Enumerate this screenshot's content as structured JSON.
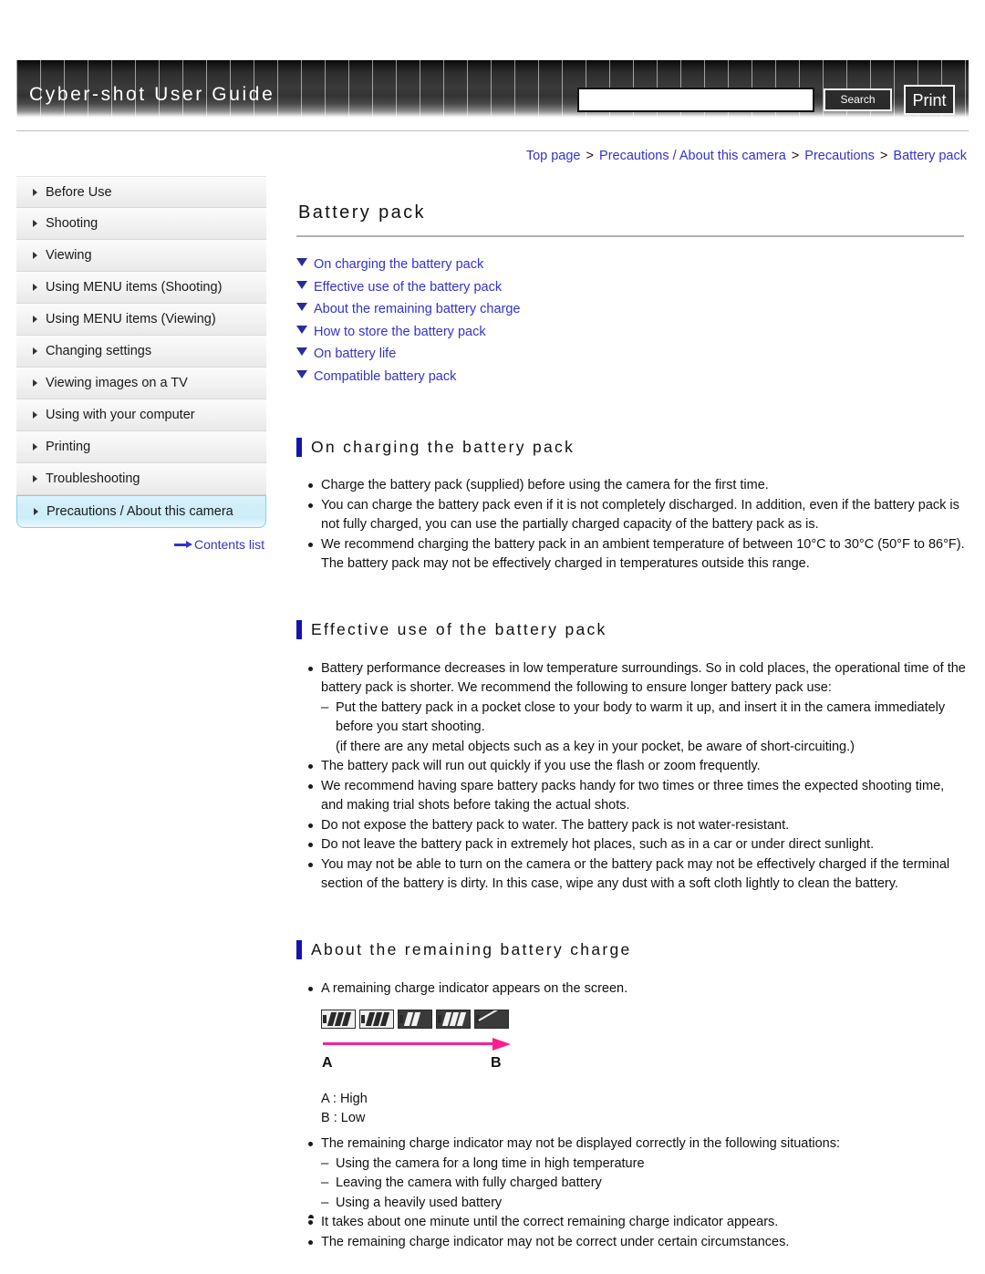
{
  "header": {
    "title": "Cyber-shot User Guide",
    "search_value": "",
    "search_placeholder": "",
    "search_button": "Search",
    "print_button": "Print"
  },
  "breadcrumb": {
    "items": [
      "Top page",
      "Precautions / About this camera",
      "Precautions",
      "Battery pack"
    ],
    "separator": ">"
  },
  "sidebar": {
    "items": [
      {
        "label": "Before Use",
        "active": false
      },
      {
        "label": "Shooting",
        "active": false
      },
      {
        "label": "Viewing",
        "active": false
      },
      {
        "label": "Using MENU items (Shooting)",
        "active": false
      },
      {
        "label": "Using MENU items (Viewing)",
        "active": false
      },
      {
        "label": "Changing settings",
        "active": false
      },
      {
        "label": "Viewing images on a TV",
        "active": false
      },
      {
        "label": "Using with your computer",
        "active": false
      },
      {
        "label": "Printing",
        "active": false
      },
      {
        "label": "Troubleshooting",
        "active": false
      },
      {
        "label": "Precautions / About this camera",
        "active": true
      }
    ],
    "contents_link": "Contents list"
  },
  "main": {
    "page_title": "Battery pack",
    "jump_links": [
      "On charging the battery pack",
      "Effective use of the battery pack",
      "About the remaining battery charge",
      "How to store the battery pack",
      "On battery life",
      "Compatible battery pack"
    ],
    "sections": [
      {
        "heading": "On charging the battery pack",
        "items": [
          {
            "type": "bullet",
            "text": "Charge the battery pack (supplied) before using the camera for the first time."
          },
          {
            "type": "bullet",
            "text": "You can charge the battery pack even if it is not completely discharged. In addition, even if the battery pack is not fully charged, you can use the partially charged capacity of the battery pack as is."
          },
          {
            "type": "bullet",
            "text": "We recommend charging the battery pack in an ambient temperature of between 10°C to 30°C (50°F to 86°F). The battery pack may not be effectively charged in temperatures outside this range."
          }
        ]
      },
      {
        "heading": "Effective use of the battery pack",
        "items": [
          {
            "type": "bullet",
            "text": "Battery performance decreases in low temperature surroundings. So in cold places, the operational time of the battery pack is shorter. We recommend the following to ensure longer battery pack use:"
          },
          {
            "type": "dash",
            "text": "Put the battery pack in a pocket close to your body to warm it up, and insert it in the camera immediately before you start shooting."
          },
          {
            "type": "plain",
            "text": "(if there are any metal objects such as a key in your pocket, be aware of short-circuiting.)"
          },
          {
            "type": "bullet",
            "text": "The battery pack will run out quickly if you use the flash or zoom frequently."
          },
          {
            "type": "bullet",
            "text": "We recommend having spare battery packs handy for two times or three times the expected shooting time, and making trial shots before taking the actual shots."
          },
          {
            "type": "bullet",
            "text": "Do not expose the battery pack to water. The battery pack is not water-resistant."
          },
          {
            "type": "bullet",
            "text": "Do not leave the battery pack in extremely hot places, such as in a car or under direct sunlight."
          },
          {
            "type": "bullet",
            "text": "You may not be able to turn on the camera or the battery pack may not be effectively charged if the terminal section of the battery is dirty. In this case, wipe any dust with a soft cloth lightly to clean the battery."
          }
        ]
      },
      {
        "heading": "About the remaining battery charge",
        "items": [
          {
            "type": "bullet",
            "text": "A remaining charge indicator appears on the screen."
          }
        ]
      }
    ],
    "battery_figure": {
      "label_a": "A",
      "label_b": "B",
      "legend_a": "A : High",
      "legend_b": "B : Low",
      "arrow_color": "#ff1e8e",
      "indicators": [
        {
          "bars": 3,
          "style": "light",
          "empty": false
        },
        {
          "bars": 3,
          "style": "light",
          "empty": false
        },
        {
          "bars": 2,
          "style": "dark",
          "empty": false
        },
        {
          "bars": 3,
          "style": "dark",
          "empty": false
        },
        {
          "bars": 0,
          "style": "dark",
          "empty": true
        }
      ]
    },
    "post_figure_items": [
      {
        "type": "bullet",
        "text": "The remaining charge indicator may not be displayed correctly in the following situations:"
      },
      {
        "type": "dash",
        "text": "Using the camera for a long time in high temperature"
      },
      {
        "type": "dash",
        "text": "Leaving the camera with fully charged battery"
      },
      {
        "type": "dash",
        "text": "Using a heavily used battery"
      },
      {
        "type": "bullet",
        "text": "It takes about one minute until the correct remaining charge indicator appears."
      },
      {
        "type": "bullet",
        "text": "The remaining charge indicator may not be correct under certain circumstances."
      }
    ]
  },
  "colors": {
    "link": "#3333cc",
    "accent_bar": "#1414aa",
    "active_item_bg": "#cfeef9",
    "arrow_pink": "#ff1e8e"
  }
}
